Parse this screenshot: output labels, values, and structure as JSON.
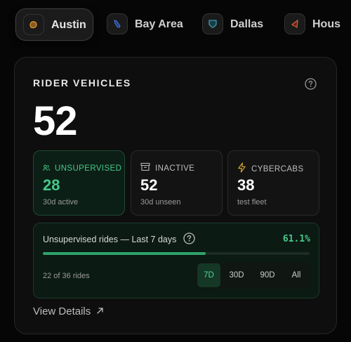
{
  "tabs": [
    {
      "label": "Austin",
      "icon": "austin-map-icon",
      "active": true,
      "color": "#d98a2a"
    },
    {
      "label": "Bay Area",
      "icon": "bay-area-map-icon",
      "active": false,
      "color": "#3a63c9"
    },
    {
      "label": "Dallas",
      "icon": "dallas-map-icon",
      "active": false,
      "color": "#38a8c4"
    },
    {
      "label": "Hous",
      "icon": "houston-map-icon",
      "active": false,
      "color": "#e0593a"
    }
  ],
  "card": {
    "title": "RIDER VEHICLES",
    "total": "52",
    "help_icon": "help-circle-icon"
  },
  "stats": {
    "unsupervised": {
      "label": "UNSUPERVISED",
      "value": "28",
      "sub": "30d active",
      "icon": "users-icon",
      "color": "#45c98a"
    },
    "inactive": {
      "label": "INACTIVE",
      "value": "52",
      "sub": "30d unseen",
      "icon": "archive-icon"
    },
    "cybercabs": {
      "label": "CYBERCABS",
      "value": "38",
      "sub": "test fleet",
      "icon": "lightning-icon",
      "color": "#d4a234"
    }
  },
  "rides": {
    "title": "Unsupervised rides — Last 7 days",
    "percent": "61.1%",
    "progress": 0.611,
    "count_text": "22 of 36 rides",
    "ranges": [
      "7D",
      "30D",
      "90D",
      "All"
    ],
    "selected_range": "7D"
  },
  "footer": {
    "view_details": "View Details",
    "icon": "arrow-up-right-icon"
  }
}
